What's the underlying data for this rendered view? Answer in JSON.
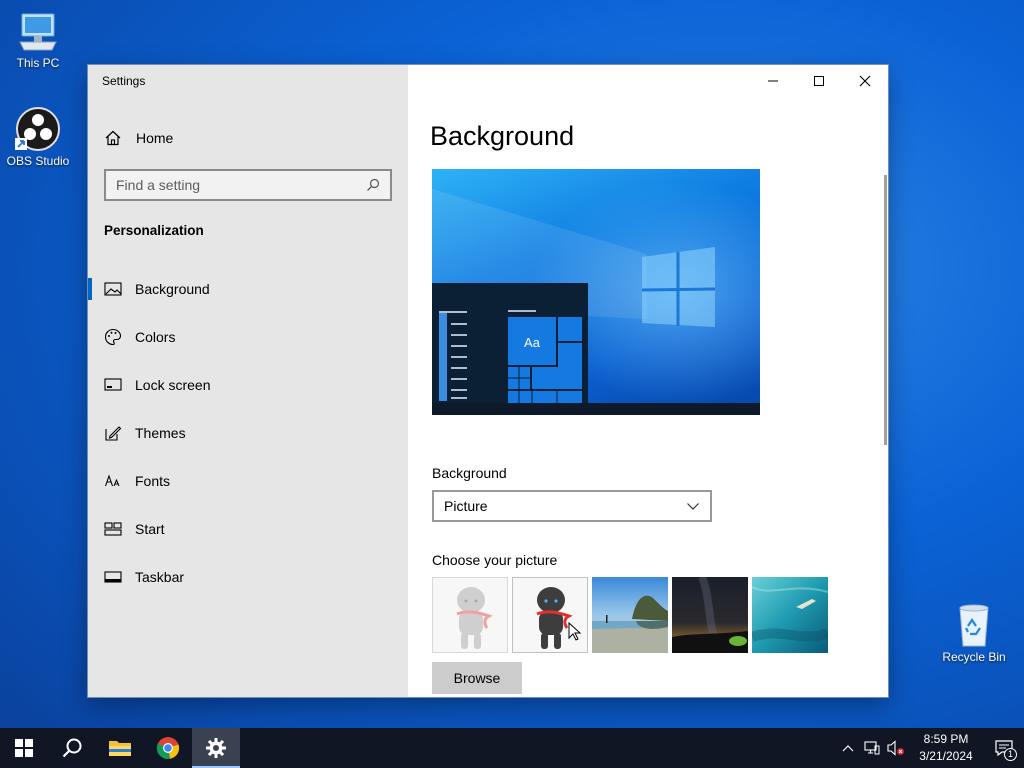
{
  "desktop": {
    "icons": [
      {
        "label": "This PC"
      },
      {
        "label": "OBS Studio"
      },
      {
        "label": "Recycle Bin"
      }
    ]
  },
  "window": {
    "title": "Settings",
    "sidebar": {
      "home_label": "Home",
      "search_placeholder": "Find a setting",
      "section_title": "Personalization",
      "items": [
        {
          "label": "Background",
          "icon": "picture-icon",
          "active": true
        },
        {
          "label": "Colors",
          "icon": "palette-icon"
        },
        {
          "label": "Lock screen",
          "icon": "lock-screen-icon"
        },
        {
          "label": "Themes",
          "icon": "themes-icon"
        },
        {
          "label": "Fonts",
          "icon": "fonts-icon"
        },
        {
          "label": "Start",
          "icon": "start-icon"
        },
        {
          "label": "Taskbar",
          "icon": "taskbar-icon"
        }
      ]
    },
    "content": {
      "page_title": "Background",
      "preview_tile_text": "Aa",
      "background_label": "Background",
      "background_value": "Picture",
      "choose_label": "Choose your picture",
      "browse_label": "Browse"
    }
  },
  "taskbar": {
    "time": "8:59 PM",
    "date": "3/21/2024",
    "notification_count": "1"
  },
  "colors": {
    "accent": "#0067c0",
    "sidebar_bg": "#e6e6e6",
    "taskbar_bg": "#101623"
  }
}
